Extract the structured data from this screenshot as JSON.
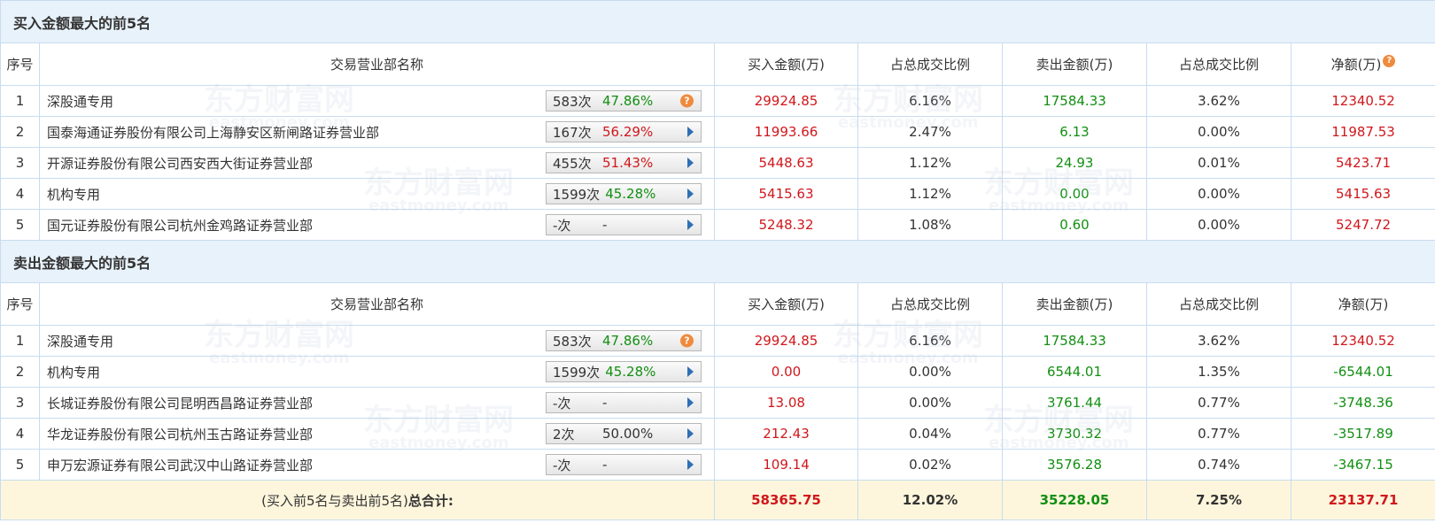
{
  "buy_section": {
    "title": "买入金额最大的前5名",
    "headers": [
      "序号",
      "交易营业部名称",
      "买入金额(万)",
      "占总成交比例",
      "卖出金额(万)",
      "占总成交比例",
      "净额(万)"
    ],
    "net_help_icon": "question-icon",
    "rows": [
      {
        "idx": "1",
        "name": "深股通专用",
        "count": "583次",
        "pct": "47.86%",
        "pct_color": "green",
        "icon": "question-icon",
        "buy": "29924.85",
        "buy_ratio": "6.16%",
        "sell": "17584.33",
        "sell_ratio": "3.62%",
        "net": "12340.52",
        "net_color": "red"
      },
      {
        "idx": "2",
        "name": "国泰海通证券股份有限公司上海静安区新闸路证券营业部",
        "count": "167次",
        "pct": "56.29%",
        "pct_color": "red",
        "icon": "play-arrow-icon",
        "buy": "11993.66",
        "buy_ratio": "2.47%",
        "sell": "6.13",
        "sell_ratio": "0.00%",
        "net": "11987.53",
        "net_color": "red"
      },
      {
        "idx": "3",
        "name": "开源证券股份有限公司西安西大街证券营业部",
        "count": "455次",
        "pct": "51.43%",
        "pct_color": "red",
        "icon": "play-arrow-icon",
        "buy": "5448.63",
        "buy_ratio": "1.12%",
        "sell": "24.93",
        "sell_ratio": "0.01%",
        "net": "5423.71",
        "net_color": "red"
      },
      {
        "idx": "4",
        "name": "机构专用",
        "count": "1599次",
        "pct": "45.28%",
        "pct_color": "green",
        "icon": "play-arrow-icon",
        "buy": "5415.63",
        "buy_ratio": "1.12%",
        "sell": "0.00",
        "sell_ratio": "0.00%",
        "net": "5415.63",
        "net_color": "red"
      },
      {
        "idx": "5",
        "name": "国元证券股份有限公司杭州金鸡路证券营业部",
        "count": "-次",
        "pct": "-",
        "pct_color": "dark",
        "icon": "play-arrow-icon",
        "buy": "5248.32",
        "buy_ratio": "1.08%",
        "sell": "0.60",
        "sell_ratio": "0.00%",
        "net": "5247.72",
        "net_color": "red"
      }
    ]
  },
  "sell_section": {
    "title": "卖出金额最大的前5名",
    "headers": [
      "序号",
      "交易营业部名称",
      "买入金额(万)",
      "占总成交比例",
      "卖出金额(万)",
      "占总成交比例",
      "净额(万)"
    ],
    "rows": [
      {
        "idx": "1",
        "name": "深股通专用",
        "count": "583次",
        "pct": "47.86%",
        "pct_color": "green",
        "icon": "question-icon",
        "buy": "29924.85",
        "buy_ratio": "6.16%",
        "sell": "17584.33",
        "sell_ratio": "3.62%",
        "net": "12340.52",
        "net_color": "red"
      },
      {
        "idx": "2",
        "name": "机构专用",
        "count": "1599次",
        "pct": "45.28%",
        "pct_color": "green",
        "icon": "play-arrow-icon",
        "buy": "0.00",
        "buy_ratio": "0.00%",
        "sell": "6544.01",
        "sell_ratio": "1.35%",
        "net": "-6544.01",
        "net_color": "green"
      },
      {
        "idx": "3",
        "name": "长城证券股份有限公司昆明西昌路证券营业部",
        "count": "-次",
        "pct": "-",
        "pct_color": "dark",
        "icon": "play-arrow-icon",
        "buy": "13.08",
        "buy_ratio": "0.00%",
        "sell": "3761.44",
        "sell_ratio": "0.77%",
        "net": "-3748.36",
        "net_color": "green"
      },
      {
        "idx": "4",
        "name": "华龙证券股份有限公司杭州玉古路证券营业部",
        "count": "2次",
        "pct": "50.00%",
        "pct_color": "dark",
        "icon": "play-arrow-icon",
        "buy": "212.43",
        "buy_ratio": "0.04%",
        "sell": "3730.32",
        "sell_ratio": "0.77%",
        "net": "-3517.89",
        "net_color": "green"
      },
      {
        "idx": "5",
        "name": "申万宏源证券有限公司武汉中山路证券营业部",
        "count": "-次",
        "pct": "-",
        "pct_color": "dark",
        "icon": "play-arrow-icon",
        "buy": "109.14",
        "buy_ratio": "0.02%",
        "sell": "3576.28",
        "sell_ratio": "0.74%",
        "net": "-3467.15",
        "net_color": "green"
      }
    ]
  },
  "total": {
    "label_prefix": "(买入前5名与卖出前5名)",
    "label_suffix": "总合计:",
    "buy": "58365.75",
    "buy_ratio": "12.02%",
    "sell": "35228.05",
    "sell_ratio": "7.25%",
    "net": "23137.71"
  },
  "watermark": {
    "cn": "东方财富网",
    "en": "eastmoney.com"
  },
  "colors": {
    "red": "#d0171c",
    "green": "#128f12",
    "header_bg": "#e8f2fb",
    "total_bg": "#fdf6dc",
    "border": "#c8dcf0"
  }
}
